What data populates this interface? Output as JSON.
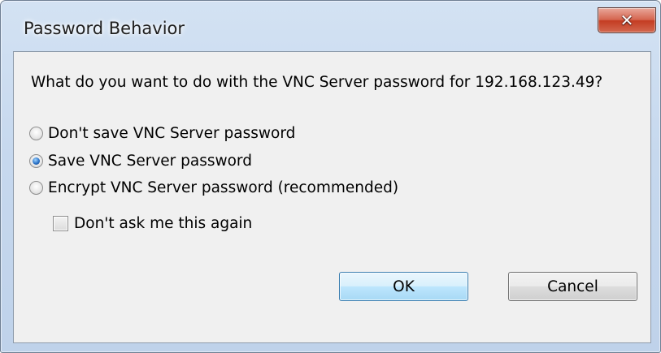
{
  "window": {
    "title": "Password Behavior",
    "close_glyph": "✕"
  },
  "dialog": {
    "question": "What do you want to do with the VNC Server password for 192.168.123.49?",
    "options": [
      {
        "label": "Don't save VNC Server password",
        "checked": false
      },
      {
        "label": "Save VNC Server password",
        "checked": true
      },
      {
        "label": "Encrypt VNC Server password (recommended)",
        "checked": false
      }
    ],
    "dont_ask_label": "Don't ask me this again",
    "dont_ask_checked": false,
    "ok_label": "OK",
    "cancel_label": "Cancel"
  },
  "colors": {
    "titlebar": "#c6d8ee",
    "client": "#f0f0f0",
    "close_button": "#c43c22",
    "default_button_border": "#3c7fb1"
  }
}
